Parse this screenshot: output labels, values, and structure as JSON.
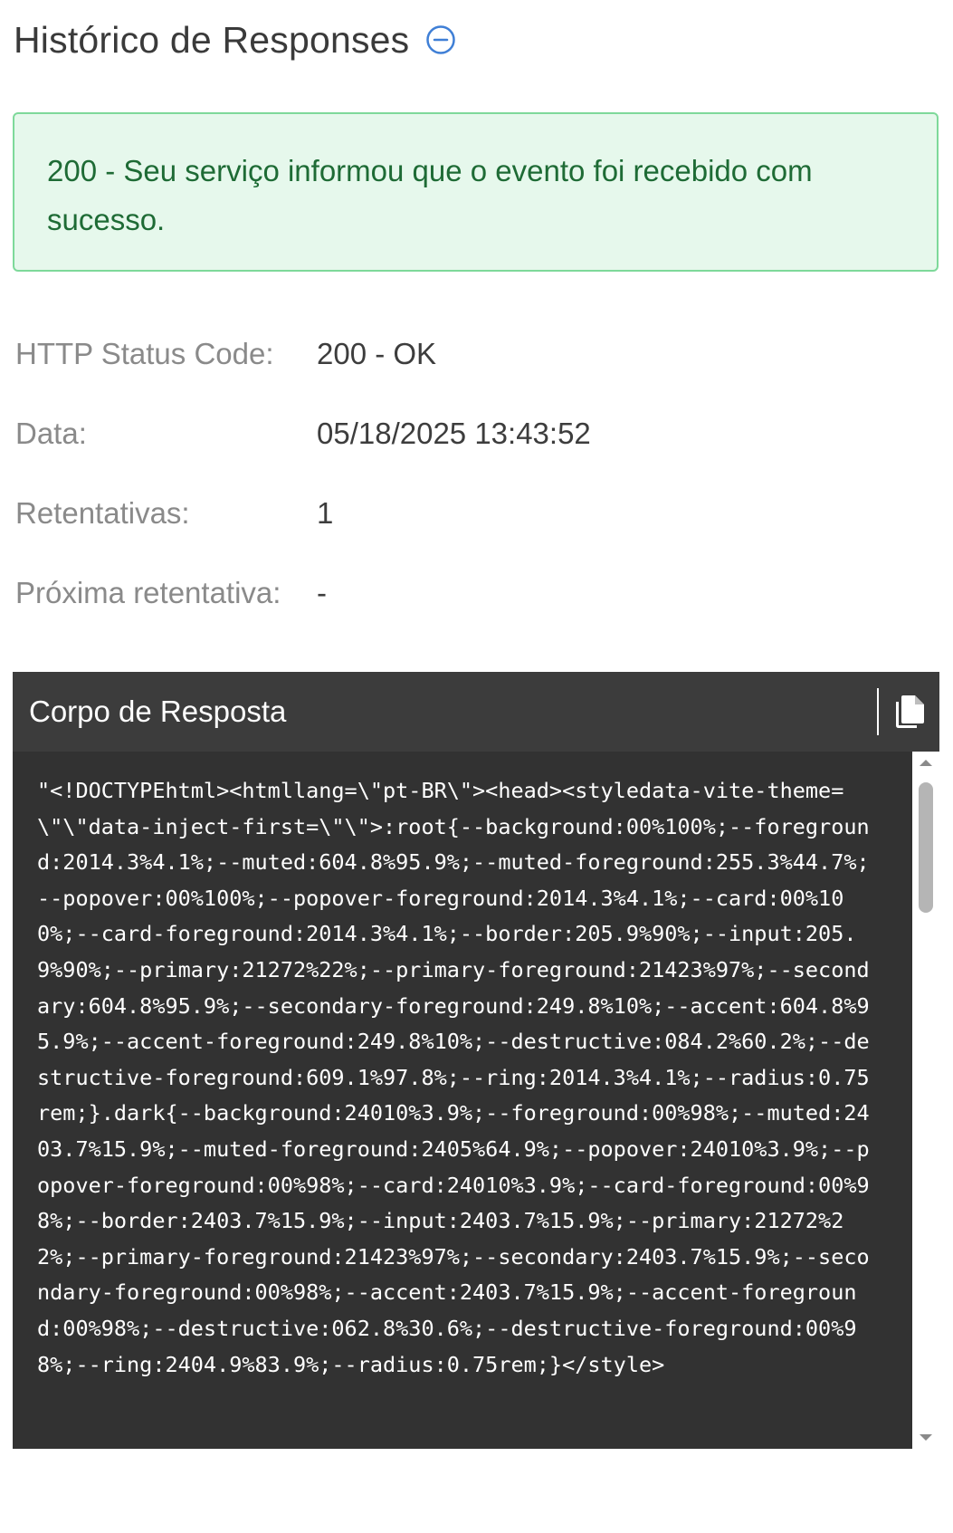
{
  "header": {
    "title": "Histórico de Responses",
    "collapse_icon": "minus-circle-icon",
    "accent_color": "#3f7fd6"
  },
  "alert": {
    "message": "200 - Seu serviço informou que o evento foi recebido com sucesso.",
    "background": "#e6f8ec",
    "border_color": "#7ed99a",
    "text_color": "#1e6b35"
  },
  "details": [
    {
      "label": "HTTP Status Code:",
      "value": "200 - OK"
    },
    {
      "label": "Data:",
      "value": "05/18/2025 13:43:52"
    },
    {
      "label": "Retentativas:",
      "value": "1"
    },
    {
      "label": "Próxima retentativa:",
      "value": "-"
    }
  ],
  "response_panel": {
    "title": "Corpo de Resposta",
    "copy_icon": "copy-icon",
    "body": "\"<!DOCTYPEhtml><htmllang=\\\"pt-BR\\\"><head><styledata-vite-theme=\\\"\\\"data-inject-first=\\\"\\\">:root{--background:00%100%;--foreground:2014.3%4.1%;--muted:604.8%95.9%;--muted-foreground:255.3%44.7%;--popover:00%100%;--popover-foreground:2014.3%4.1%;--card:00%100%;--card-foreground:2014.3%4.1%;--border:205.9%90%;--input:205.9%90%;--primary:21272%22%;--primary-foreground:21423%97%;--secondary:604.8%95.9%;--secondary-foreground:249.8%10%;--accent:604.8%95.9%;--accent-foreground:249.8%10%;--destructive:084.2%60.2%;--destructive-foreground:609.1%97.8%;--ring:2014.3%4.1%;--radius:0.75rem;}.dark{--background:24010%3.9%;--foreground:00%98%;--muted:2403.7%15.9%;--muted-foreground:2405%64.9%;--popover:24010%3.9%;--popover-foreground:00%98%;--card:24010%3.9%;--card-foreground:00%98%;--border:2403.7%15.9%;--input:2403.7%15.9%;--primary:21272%22%;--primary-foreground:21423%97%;--secondary:2403.7%15.9%;--secondary-foreground:00%98%;--accent:2403.7%15.9%;--accent-foreground:00%98%;--destructive:062.8%30.6%;--destructive-foreground:00%98%;--ring:2404.9%83.9%;--radius:0.75rem;}</style>",
    "background": "#323232",
    "header_background": "#3c3c3c"
  }
}
